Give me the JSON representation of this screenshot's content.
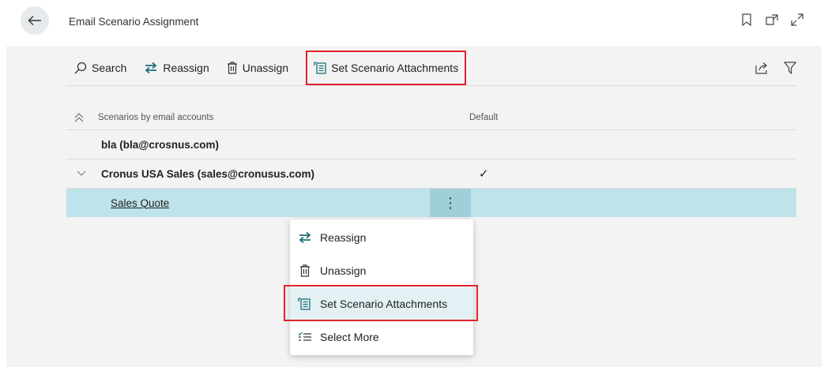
{
  "header": {
    "title": "Email Scenario Assignment",
    "back_icon": "arrow-left-icon",
    "icons": [
      "bookmark-icon",
      "open-in-new-window-icon",
      "expand-icon"
    ]
  },
  "actions": {
    "search": "Search",
    "reassign": "Reassign",
    "unassign": "Unassign",
    "set_attachments": "Set Scenario Attachments"
  },
  "list": {
    "col_name": "Scenarios by email accounts",
    "col_default": "Default",
    "rows": [
      {
        "label": "bla (bla@crosnus.com)",
        "default": ""
      },
      {
        "label": "Cronus USA Sales (sales@cronusus.com)",
        "default": "✓"
      },
      {
        "label": "Sales Quote",
        "default": ""
      }
    ],
    "dots": "⋮"
  },
  "context_menu": {
    "items": [
      "Reassign",
      "Unassign",
      "Set Scenario Attachments",
      "Select More"
    ]
  },
  "colors": {
    "highlight_border": "#e0232e",
    "selected_row": "#bfe3ea",
    "accent_teal": "#1d6f7a"
  }
}
